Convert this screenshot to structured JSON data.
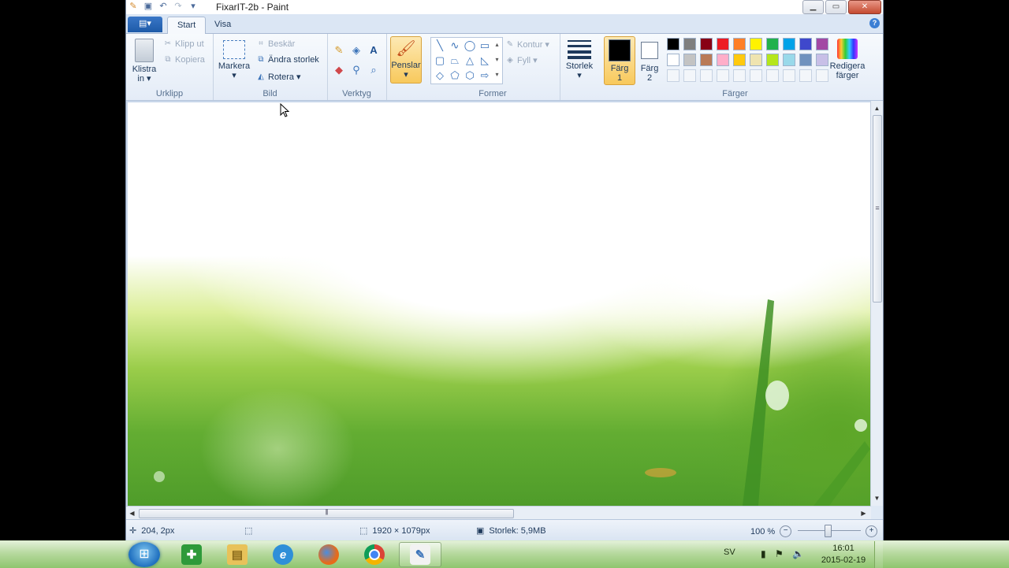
{
  "window": {
    "title": "FixarIT-2b - Paint",
    "qat_icons": [
      "paint-app-icon",
      "save-icon",
      "undo-icon",
      "redo-icon",
      "customize-qat-icon"
    ],
    "controls": [
      "minimize",
      "maximize",
      "close"
    ]
  },
  "tabs": {
    "file_glyph": "▤▾",
    "items": [
      {
        "label": "Start",
        "active": true
      },
      {
        "label": "Visa",
        "active": false
      }
    ],
    "help": "?"
  },
  "ribbon": {
    "clipboard": {
      "group_label": "Urklipp",
      "paste_label": "Klistra",
      "paste_label2": "in",
      "cut_label": "Klipp ut",
      "copy_label": "Kopiera"
    },
    "image": {
      "group_label": "Bild",
      "select_label": "Markera",
      "crop_label": "Beskär",
      "resize_label": "Ändra storlek",
      "rotate_label": "Rotera"
    },
    "tools": {
      "group_label": "Verktyg",
      "items": [
        "pencil-icon",
        "fill-icon",
        "text-icon",
        "eraser-icon",
        "color-picker-icon",
        "magnifier-icon"
      ]
    },
    "brushes": {
      "label": "Penslar"
    },
    "shapes": {
      "group_label": "Former",
      "outline_label": "Kontur",
      "fill_label": "Fyll"
    },
    "size": {
      "label": "Storlek"
    },
    "colors": {
      "group_label": "Färger",
      "color1_label": "Färg",
      "color1_num": "1",
      "color2_label": "Färg",
      "color2_num": "2",
      "color1": "#000000",
      "color2": "#ffffff",
      "edit_label": "Redigera",
      "edit_label2": "färger",
      "palette_row1": [
        "#000000",
        "#7f7f7f",
        "#880015",
        "#ed1c24",
        "#ff7f27",
        "#fff200",
        "#22b14c",
        "#00a2e8",
        "#3f48cc",
        "#a349a4"
      ],
      "palette_row2": [
        "#ffffff",
        "#c3c3c3",
        "#b97a57",
        "#ffaec9",
        "#ffc90e",
        "#efe4b0",
        "#b5e61d",
        "#99d9ea",
        "#7092be",
        "#c8bfe7"
      ]
    }
  },
  "status": {
    "cursor_pos": "204, 2px",
    "image_size": "1920 × 1079px",
    "file_size": "Storlek: 5,9MB",
    "zoom": "100 %"
  },
  "taskbar": {
    "apps": [
      "start-button",
      "app-green-icon",
      "explorer-icon",
      "ie-icon",
      "firefox-icon",
      "chrome-icon",
      "paint-icon"
    ],
    "lang": "SV",
    "time": "16:01",
    "date": "2015-02-19"
  }
}
